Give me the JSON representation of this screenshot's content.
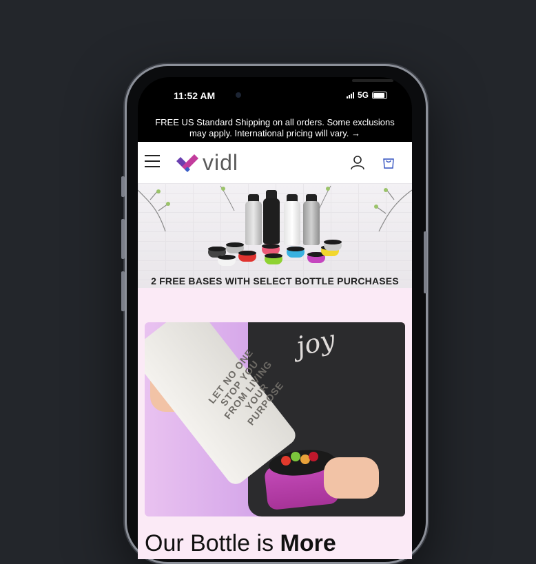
{
  "status_bar": {
    "time": "11:52 AM",
    "network": "5G"
  },
  "announcement": {
    "text": "FREE US Standard Shipping on all orders. Some exclusions may apply. International pricing will vary. →"
  },
  "header": {
    "logo_text": "vidl",
    "menu_icon": "hamburger-menu-icon",
    "account_icon": "account-icon",
    "cart_icon": "cart-icon"
  },
  "banner": {
    "caption": "2 FREE BASES WITH SELECT BOTTLE PURCHASES"
  },
  "hero": {
    "shirt_text": "joy",
    "bottle_etching": "LET NO ONE STOP YOU FROM LIVING YOUR PURPOSE"
  },
  "headline": {
    "lead": "Our Bottle is ",
    "bold": "More"
  },
  "colors": {
    "accent_purple": "#5b3fa6",
    "accent_pink": "#c23c9c",
    "pink_background": "#fbeaf6"
  }
}
